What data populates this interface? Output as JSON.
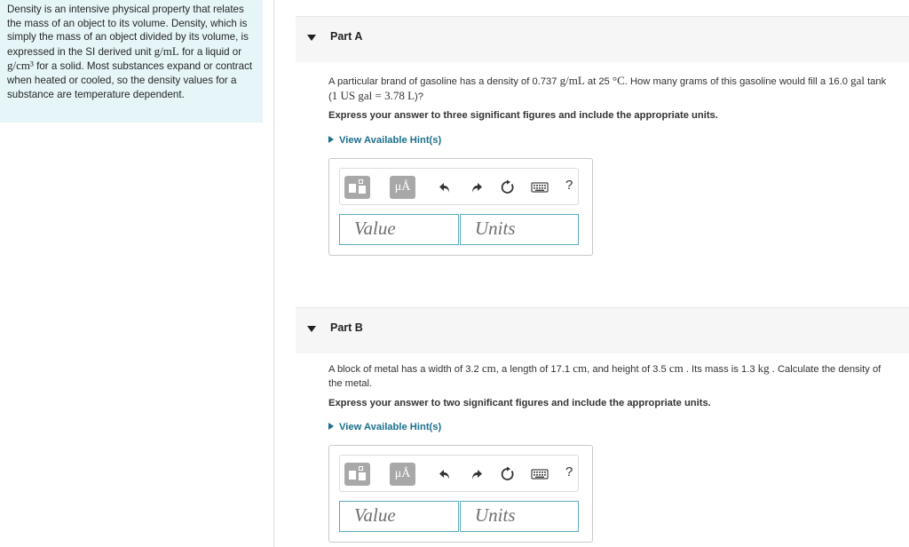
{
  "intro": {
    "t1": "Density is an intensive physical property that relates the mass of an object to its volume. Density, which is simply the mass of an object divided by its volume, is expressed in the SI derived unit",
    "m1": "g/mL",
    "t2": "for a liquid or",
    "m2": "g/cm³",
    "t3": "for a solid. Most substances expand or contract when heated or cooled, so the density values for a substance are temperature dependent."
  },
  "partA": {
    "title": "Part A",
    "q_t1": "A particular brand of gasoline has a density of 0.737",
    "q_m1": "g/mL",
    "q_t2": "at 25",
    "q_m2": "°C",
    "q_t3": ". How many grams of this gasoline would fill a 16.0",
    "q_m3": "gal",
    "q_t4": "tank (",
    "q_m4": "1 US gal = 3.78 L",
    "q_t5": ")?",
    "instruction": "Express your answer to three significant figures and include the appropriate units.",
    "hint": "View Available Hint(s)",
    "value_placeholder": "Value",
    "units_placeholder": "Units"
  },
  "partB": {
    "title": "Part B",
    "q_t1": "A block of metal has a width of 3.2",
    "q_m1": "cm",
    "q_t2": ", a length of 17.1",
    "q_m2": "cm",
    "q_t3": ", and height of 3.5",
    "q_m3": "cm",
    "q_t4": ". Its mass is 1.3",
    "q_m4": "kg",
    "q_t5": ". Calculate the density of the metal.",
    "instruction": "Express your answer to two significant figures and include the appropriate units.",
    "hint": "View Available Hint(s)",
    "value_placeholder": "Value",
    "units_placeholder": "Units"
  },
  "toolbar": {
    "mu_label": "μÅ",
    "help_label": "?",
    "icons": [
      "templates-icon",
      "units-icon",
      "undo-icon",
      "redo-icon",
      "reset-icon",
      "keyboard-icon",
      "help-icon"
    ]
  }
}
